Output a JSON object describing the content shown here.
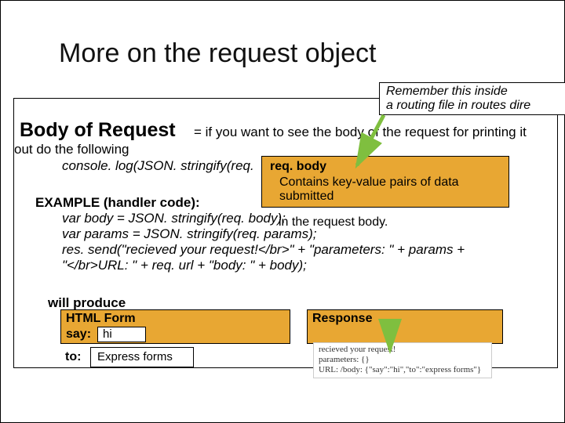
{
  "title": "More on the request object",
  "note": {
    "line1": "Remember this inside",
    "line2": "a routing file in routes dire"
  },
  "body_req_label": "Body of Request",
  "body_req_desc": " = if you want to see the body of the request for printing it",
  "out_line": "out do the following",
  "console_line": "console. log(JSON. stringify(req.",
  "callout": {
    "heading": "req. body",
    "line2": "Contains key-value pairs of data",
    "line3": "submitted"
  },
  "inthe": "in the request body.",
  "example_label": "EXAMPLE (handler code):",
  "code": {
    "l1": "var body = JSON. stringify(req. body);",
    "l2": "var params = JSON. stringify(req. params);",
    "l3": "res. send(\"recieved your request!</br>\" + \"parameters: \" + params +",
    "l4": "\"</br>URL: \" + req. url + \"body: \" + body);"
  },
  "will_produce": "will produce",
  "form": {
    "header": "HTML Form",
    "say_label": "say:",
    "say_value": "hi",
    "to_label": "to:",
    "to_value": "Express forms"
  },
  "response": {
    "header": "Response",
    "line1": "recieved your request!",
    "line2": "parameters: {}",
    "line3": "URL: /body: {\"say\":\"hi\",\"to\":\"express forms\"}"
  }
}
